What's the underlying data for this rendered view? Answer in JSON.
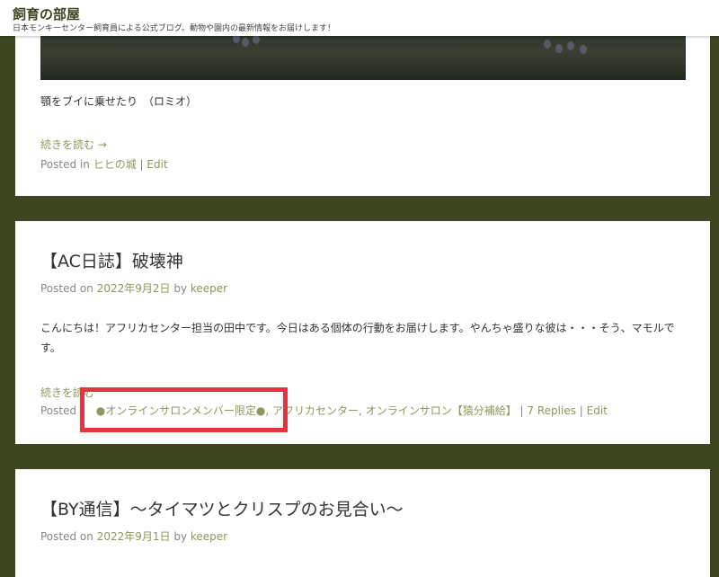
{
  "site": {
    "title": "飼育の部屋",
    "description": "日本モンキーセンター飼育員による公式ブログ。動物や園内の最新情報をお届けします！"
  },
  "posts": [
    {
      "caption": "顎をブイに乗せたり　（ロミオ）",
      "more": "続きを読む →",
      "posted_in_label": "Posted in",
      "category": "ヒヒの城",
      "sep": "|",
      "edit": "Edit"
    },
    {
      "title": "【AC日誌】破壊神",
      "posted_on_label": "Posted on",
      "date": "2022年9月2日",
      "by_label": "by",
      "author": "keeper",
      "excerpt": "こんにちは！アフリカセンター担当の田中です。今日はある個体の行動をお届けします。やんちゃ盛りな彼は・・・そう、マモルです。",
      "more": "続きを読む",
      "posted_in_label": "Posted",
      "categories": [
        "●オンラインサロンメンバー限定●",
        "アフリカセンター",
        "オンラインサロン【猿分補給】"
      ],
      "comma": ",",
      "sep": "|",
      "replies": "7 Replies",
      "edit": "Edit"
    },
    {
      "title": "【BY通信】〜タイマツとクリスプのお見合い〜",
      "posted_on_label": "Posted on",
      "date": "2022年9月1日",
      "by_label": "by",
      "author": "keeper"
    }
  ],
  "colors": {
    "page_background": "#3d4620",
    "link": "#8a9a5b",
    "highlight_border": "#e5343f"
  }
}
